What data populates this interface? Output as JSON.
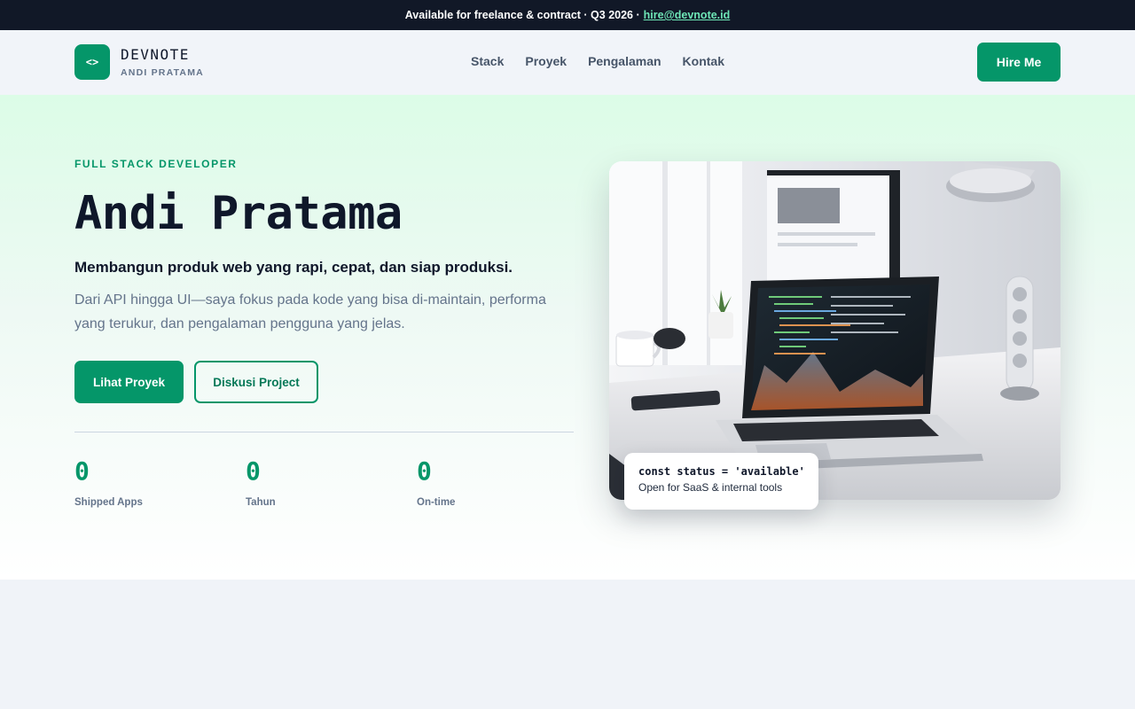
{
  "topbar": {
    "text": "Available for freelance & contract · Q3 2026 ·",
    "email": "hire@devnote.id"
  },
  "nav": {
    "logo_glyph": "<>",
    "brand_name": "DEVNOTE",
    "brand_sub": "ANDI PRATAMA",
    "links": [
      "Stack",
      "Proyek",
      "Pengalaman",
      "Kontak"
    ],
    "hire_label": "Hire Me"
  },
  "hero": {
    "eyebrow": "FULL STACK DEVELOPER",
    "title": "Andi Pratama",
    "tagline": "Membangun produk web yang rapi, cepat, dan siap produksi.",
    "description": "Dari API hingga UI—saya fokus pada kode yang bisa di-maintain, performa yang terukur, dan pengalaman pengguna yang jelas.",
    "primary_cta": "Lihat Proyek",
    "secondary_cta": "Diskusi Project",
    "stats": [
      {
        "value": "0",
        "label": "Shipped Apps"
      },
      {
        "value": "0",
        "label": "Tahun"
      },
      {
        "value": "0",
        "label": "On-time"
      }
    ],
    "status_card": {
      "code": "const status = 'available'",
      "subtitle": "Open for SaaS & internal tools"
    }
  },
  "colors": {
    "accent": "#059669",
    "topbar_bg": "#111827",
    "link": "#6ee7b7"
  }
}
